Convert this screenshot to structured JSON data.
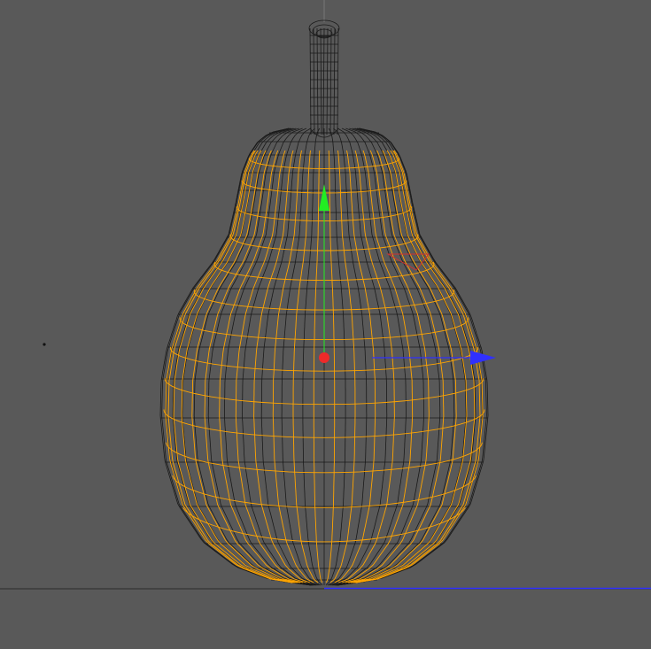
{
  "viewport": {
    "background": "#595959",
    "wire_color": "#1a1a1a",
    "isoparm_color": "#ffa500",
    "axis_x_color": "#ff2020",
    "axis_y_color": "#22ee22",
    "axis_z_color": "#3030ff",
    "horizon_color": "#2a2a2a"
  },
  "object": {
    "icon": "pear-mesh",
    "selected": true
  }
}
